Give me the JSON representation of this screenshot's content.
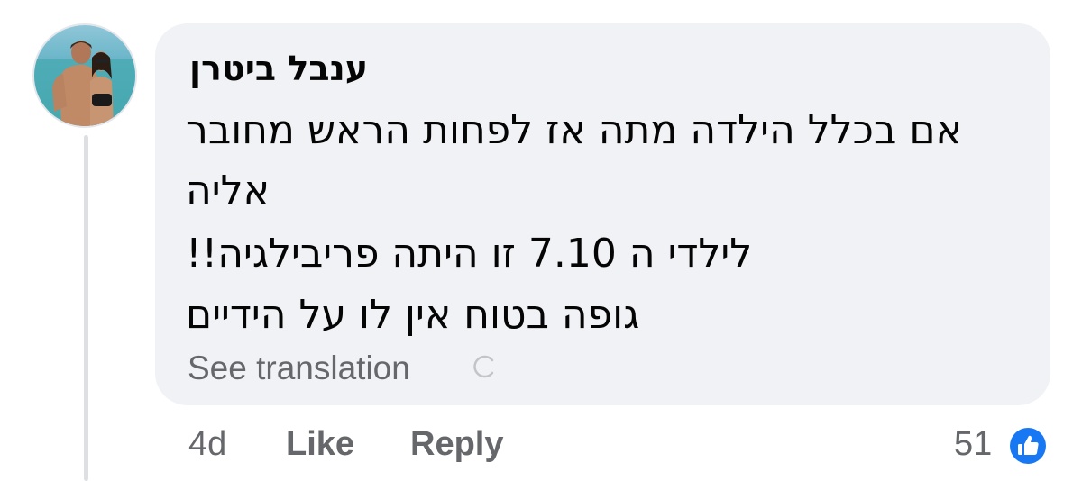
{
  "comment": {
    "author": "ענבל ביטרן",
    "body_lines": [
      "אם בכלל הילדה מתה אז לפחות הראש מחובר",
      "אליה",
      "לילדי ה 7.10 זו היתה פריבילגיה!!",
      "גופה בטוח אין לו על הידיים"
    ],
    "see_translation": "See translation",
    "timestamp": "4d",
    "like_label": "Like",
    "reply_label": "Reply",
    "reaction_count": "51",
    "reaction_icon": "thumbs-up-icon",
    "accent_color": "#1877f2"
  }
}
